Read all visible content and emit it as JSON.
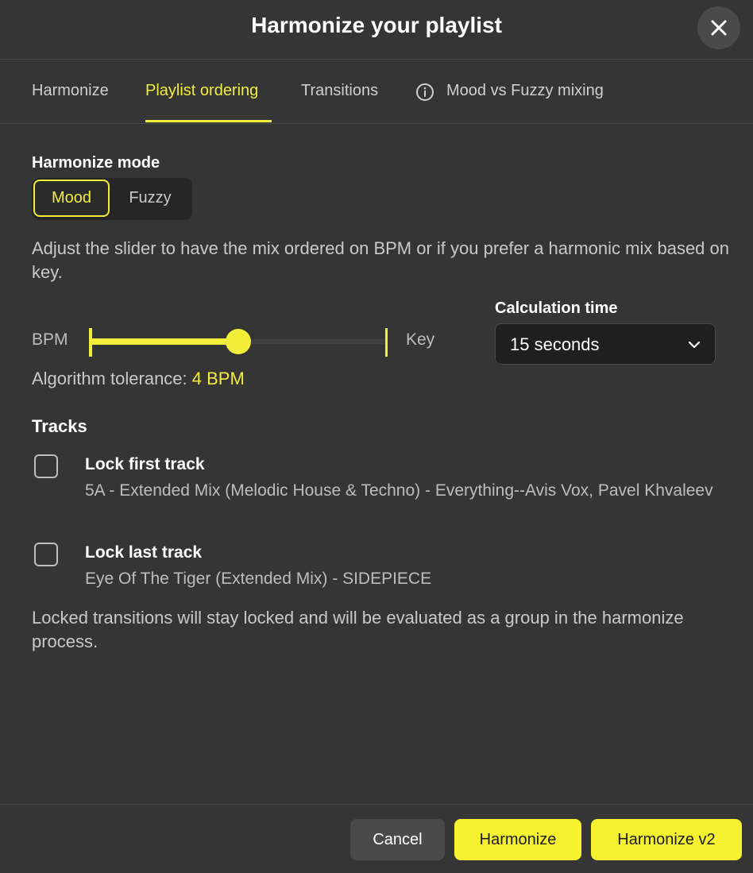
{
  "header": {
    "title": "Harmonize your playlist",
    "close_icon": "close-icon"
  },
  "tabs": [
    {
      "label": "Harmonize",
      "active": false
    },
    {
      "label": "Playlist ordering",
      "active": true
    },
    {
      "label": "Transitions",
      "active": false
    },
    {
      "label": "Mood vs Fuzzy mixing",
      "active": false,
      "icon": "info-icon"
    }
  ],
  "harmonize_mode": {
    "label": "Harmonize mode",
    "options": [
      "Mood",
      "Fuzzy"
    ],
    "selected": "Mood"
  },
  "description": "Adjust the slider to have the mix ordered on BPM or if you prefer a harmonic mix based on key.",
  "slider": {
    "left_label": "BPM",
    "right_label": "Key",
    "value_fraction": 0.5
  },
  "calculation_time": {
    "label": "Calculation time",
    "value": "15 seconds"
  },
  "tolerance": {
    "label": "Algorithm tolerance:",
    "value": "4 BPM"
  },
  "tracks": {
    "label": "Tracks",
    "lock_first": {
      "title": "Lock first track",
      "subtitle": "5A - Extended Mix (Melodic House & Techno) - Everything--Avis Vox, Pavel Khvaleev",
      "checked": false
    },
    "lock_last": {
      "title": "Lock last track",
      "subtitle": "Eye Of The Tiger (Extended Mix) - SIDEPIECE",
      "checked": false
    },
    "note": "Locked transitions will stay locked and will be evaluated as a group in the harmonize process."
  },
  "footer": {
    "cancel_label": "Cancel",
    "harmonize_label": "Harmonize",
    "harmonize_v2_label": "Harmonize v2"
  },
  "colors": {
    "accent": "#f2ee3a",
    "background": "#353535"
  }
}
